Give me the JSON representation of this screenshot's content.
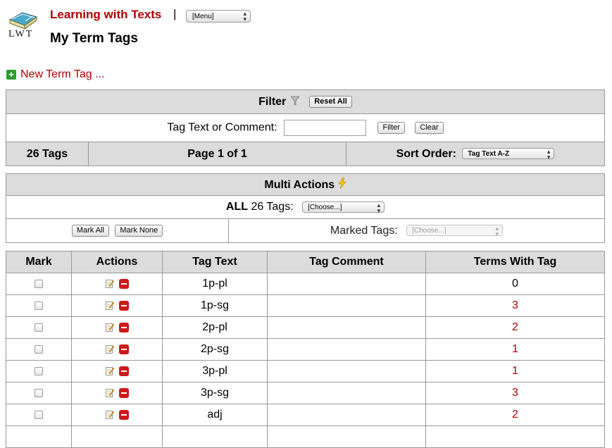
{
  "header": {
    "logo_text": "LWT",
    "app_title": "Learning with Texts",
    "separator": "|",
    "menu_value": "[Menu]",
    "page_title": "My Term Tags"
  },
  "new_tag_link": "New Term Tag ...",
  "filter": {
    "title": "Filter",
    "reset_label": "Reset All",
    "search_label": "Tag Text or Comment:",
    "search_value": "",
    "filter_button": "Filter",
    "clear_button": "Clear",
    "tag_count": "26 Tags",
    "page_info": "Page 1 of 1",
    "sort_label": "Sort Order:",
    "sort_value": "Tag Text A-Z"
  },
  "multi_actions": {
    "title": "Multi Actions",
    "all_prefix": "ALL",
    "all_count_text": "26 Tags:",
    "all_select": "[Choose...]",
    "mark_all": "Mark All",
    "mark_none": "Mark None",
    "marked_label": "Marked Tags:",
    "marked_select": "[Choose...]"
  },
  "table": {
    "columns": [
      "Mark",
      "Actions",
      "Tag Text",
      "Tag Comment",
      "Terms With Tag"
    ],
    "rows": [
      {
        "tag": "1p-pl",
        "comment": "",
        "terms": "0"
      },
      {
        "tag": "1p-sg",
        "comment": "",
        "terms": "3"
      },
      {
        "tag": "2p-pl",
        "comment": "",
        "terms": "2"
      },
      {
        "tag": "2p-sg",
        "comment": "",
        "terms": "1"
      },
      {
        "tag": "3p-pl",
        "comment": "",
        "terms": "1"
      },
      {
        "tag": "3p-sg",
        "comment": "",
        "terms": "3"
      },
      {
        "tag": "adj",
        "comment": "",
        "terms": "2"
      },
      {
        "tag": "",
        "comment": "",
        "terms": ""
      }
    ]
  },
  "colors": {
    "accent_red": "#b30000",
    "header_bg": "#dcdcdc",
    "border": "#999999",
    "plus_green": "#2e9e2e",
    "delete_red": "#cc1a1a"
  },
  "icons": {
    "logo": "lwt-book-icon",
    "plus": "plus-icon",
    "filter": "funnel-icon",
    "multi": "lightning-icon",
    "edit": "edit-icon",
    "delete": "delete-icon"
  }
}
